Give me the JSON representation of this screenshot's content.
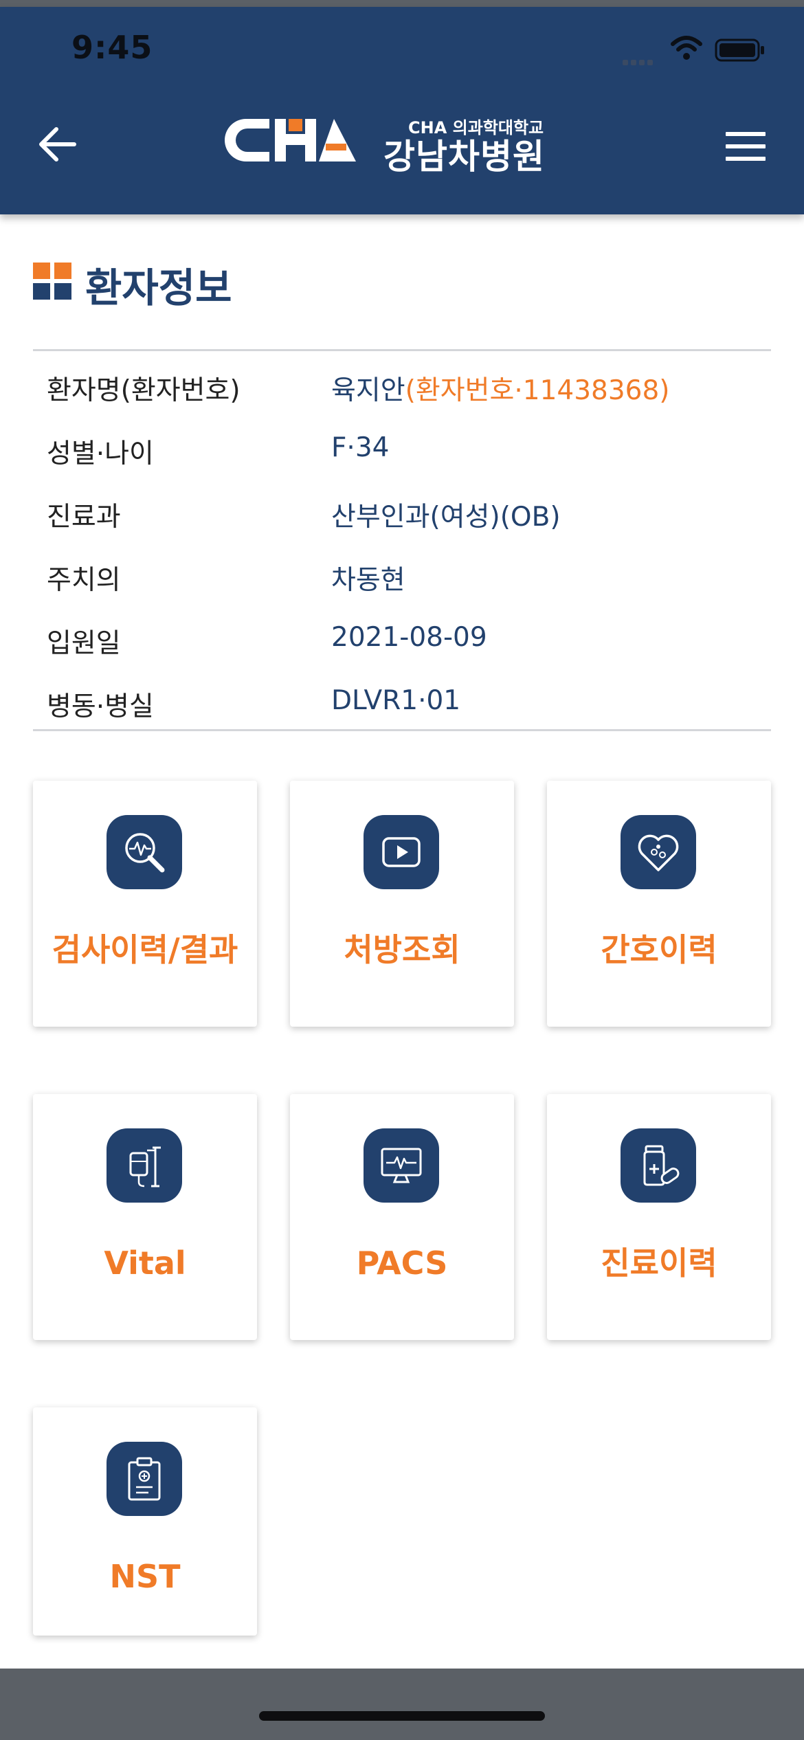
{
  "status_bar": {
    "time": "9:45"
  },
  "header": {
    "logo_sub": "CHA 의과학대학교",
    "logo_main": "강남차병원"
  },
  "section": {
    "title": "환자정보"
  },
  "patient_info": [
    {
      "label": "환자명(환자번호)",
      "value": "육지안",
      "value_extra": "(환자번호·11438368)"
    },
    {
      "label": "성별·나이",
      "value": "F·34"
    },
    {
      "label": "진료과",
      "value": "산부인과(여성)(OB)"
    },
    {
      "label": "주치의",
      "value": "차동현"
    },
    {
      "label": "입원일",
      "value": "2021-08-09"
    },
    {
      "label": "병동·병실",
      "value": "DLVR1·01"
    }
  ],
  "menu_cards": [
    {
      "label": "검사이력/결과",
      "icon": "magnifier-pulse-icon"
    },
    {
      "label": "처방조회",
      "icon": "play-button-icon"
    },
    {
      "label": "간호이력",
      "icon": "heart-pills-icon"
    },
    {
      "label": "Vital",
      "icon": "iv-drip-icon"
    },
    {
      "label": "PACS",
      "icon": "monitor-pulse-icon"
    },
    {
      "label": "진료이력",
      "icon": "medicine-bottle-icon"
    },
    {
      "label": "NST",
      "icon": "clipboard-icon"
    }
  ],
  "colors": {
    "header_bg": "#22416d",
    "accent_orange": "#f07b28",
    "text_navy": "#22416d"
  }
}
